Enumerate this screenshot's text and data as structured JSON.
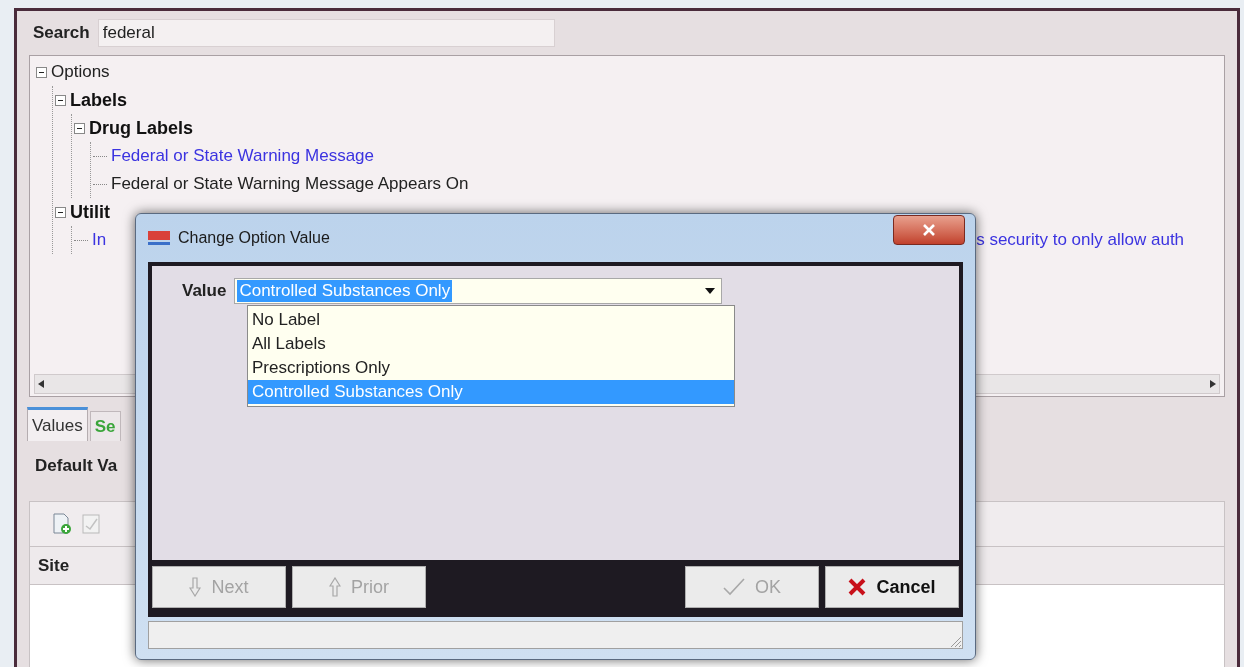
{
  "search": {
    "label": "Search",
    "value": "federal"
  },
  "tree": [
    {
      "label": "Options",
      "kind": "plain",
      "expanded": true,
      "children": [
        {
          "label": "Labels",
          "kind": "group",
          "expanded": true,
          "children": [
            {
              "label": "Drug Labels",
              "kind": "group",
              "expanded": true,
              "children": [
                {
                  "label": "Federal or State Warning Message",
                  "kind": "link"
                },
                {
                  "label": "Federal or State Warning Message Appears On",
                  "kind": "plain"
                }
              ]
            }
          ]
        },
        {
          "label": "Utilit",
          "kind": "group",
          "expanded": true,
          "children": [
            {
              "label": "In",
              "label_tail": "s security to only allow auth",
              "kind": "link"
            }
          ]
        }
      ]
    }
  ],
  "tabs": [
    {
      "label": "Values",
      "selected": true
    },
    {
      "label": "Se",
      "selected": false
    }
  ],
  "section_title": "Default Va",
  "grid": {
    "columns": [
      "Site"
    ]
  },
  "dialog": {
    "title": "Change Option Value",
    "field_label": "Value",
    "combo": {
      "value": "Controlled Substances Only",
      "text_selected": true,
      "expanded": true
    },
    "options": [
      {
        "label": "No Label",
        "selected": false
      },
      {
        "label": "All Labels",
        "selected": false
      },
      {
        "label": "Prescriptions Only",
        "selected": false
      },
      {
        "label": "Controlled Substances Only",
        "selected": true
      }
    ],
    "buttons": [
      {
        "label": "Next",
        "kind": "next",
        "disabled": true
      },
      {
        "label": "Prior",
        "kind": "prior",
        "disabled": true
      },
      {
        "label": "OK",
        "kind": "ok",
        "disabled": true
      },
      {
        "label": "Cancel",
        "kind": "cancel",
        "disabled": false
      }
    ]
  }
}
